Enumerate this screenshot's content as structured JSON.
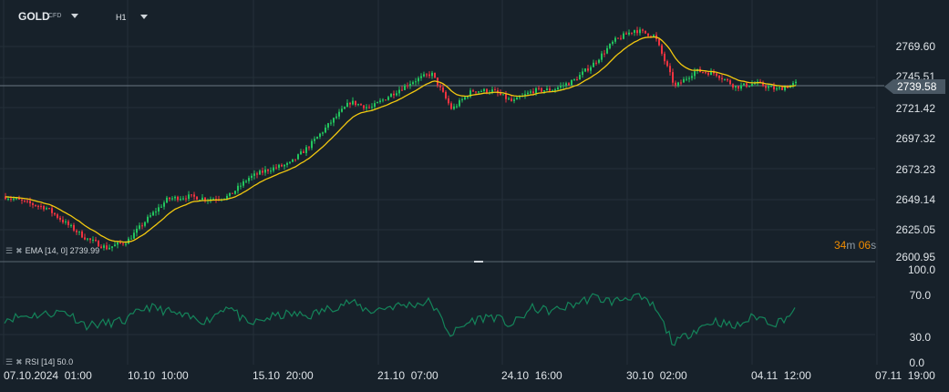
{
  "header": {
    "symbol": "GOLD",
    "symbol_type": "CFD",
    "timeframe": "H1"
  },
  "price_axis": {
    "ticks": [
      "2769.60",
      "2745.51",
      "2721.42",
      "2697.32",
      "2673.23",
      "2649.14",
      "2625.05",
      "2600.95"
    ],
    "current_price": "2739.58"
  },
  "timer": {
    "minutes": "34",
    "m": "m",
    "seconds": "06",
    "s": "s"
  },
  "indicators": {
    "ema_label": "EMA [14, 0] 2739.99",
    "rsi_label": "RSI [14]  50.0"
  },
  "rsi_axis": {
    "ticks": [
      "100.0",
      "70.0",
      "30.0",
      "0.0"
    ]
  },
  "time_axis": {
    "ticks": [
      "07.10.2024  01:00",
      "10.10  10:00",
      "15.10  20:00",
      "21.10  07:00",
      "24.10  16:00",
      "30.10  02:00",
      "04.11  12:00",
      "07.11  19:00"
    ]
  },
  "colors": {
    "background": "#17212a",
    "up": "#22c55e",
    "down": "#ef3340",
    "ema": "#f2c80f",
    "rsi": "#14845a",
    "grid": "#243039"
  },
  "chart_data": {
    "type": "candlestick",
    "ylim": [
      2600.95,
      2780
    ],
    "close_approx": [
      2649,
      2644,
      2640,
      2627,
      2615,
      2607.5,
      2613,
      2631,
      2647,
      2649,
      2647,
      2649,
      2664,
      2671,
      2675,
      2690,
      2708,
      2725,
      2720,
      2731,
      2741,
      2748,
      2719,
      2734,
      2734,
      2725,
      2734,
      2735,
      2742,
      2756,
      2774,
      2783,
      2778,
      2737,
      2750,
      2748,
      2737,
      2740,
      2735,
      2740
    ],
    "rsi_approx": [
      47,
      50,
      52,
      55,
      40,
      42,
      45,
      60,
      55,
      48,
      45,
      62,
      40,
      48,
      52,
      50,
      58,
      65,
      55,
      60,
      62,
      65,
      30,
      45,
      50,
      40,
      58,
      55,
      62,
      70,
      65,
      72,
      60,
      20,
      35,
      45,
      38,
      50,
      42,
      55
    ],
    "rsi_ylim": [
      0,
      100
    ]
  }
}
